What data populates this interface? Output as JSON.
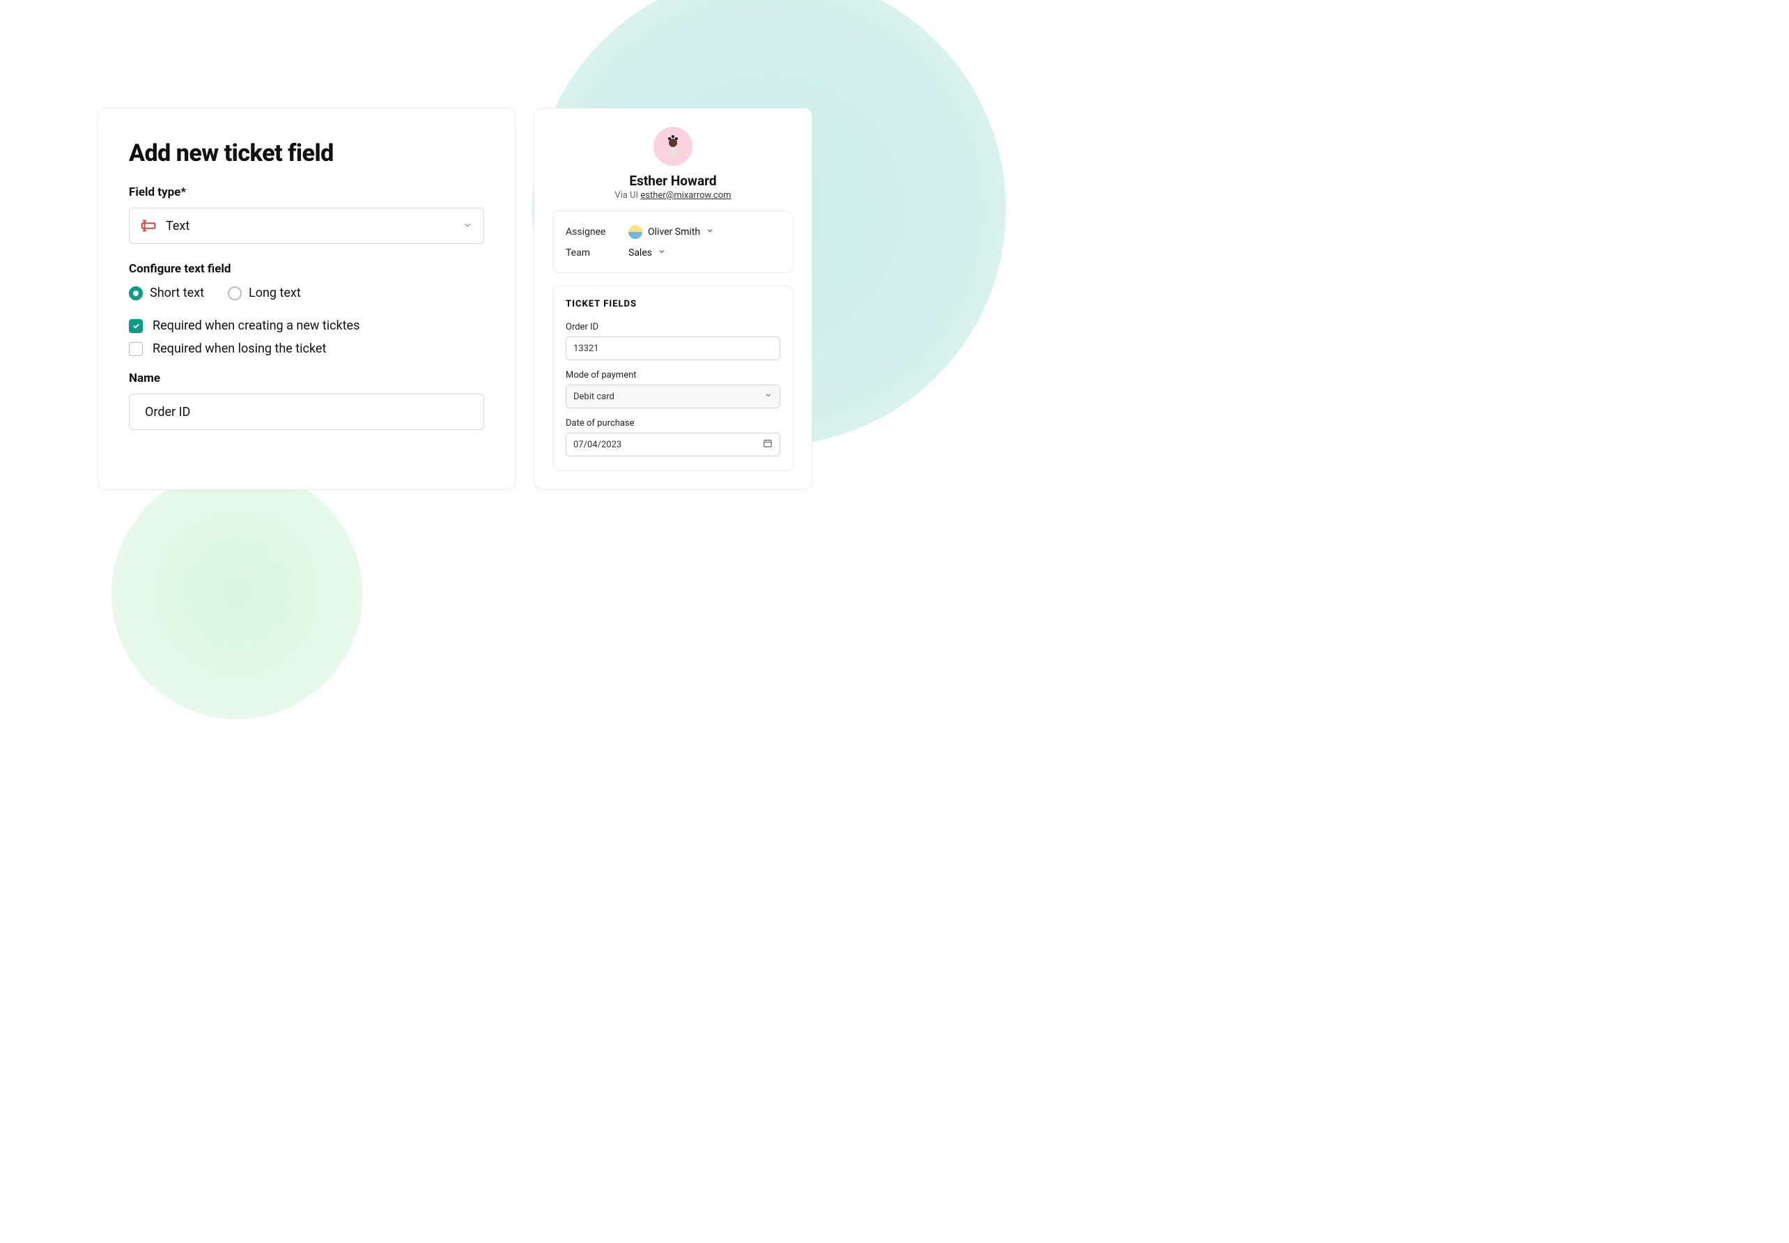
{
  "leftCard": {
    "title": "Add new ticket field",
    "fieldTypeLabel": "Field type*",
    "fieldTypeValue": "Text",
    "configureLabel": "Configure text field",
    "radioShort": "Short text",
    "radioLong": "Long text",
    "checkReqCreate": "Required when creating a new ticktes",
    "checkReqClose": "Required when losing the ticket",
    "nameLabel": "Name",
    "nameValue": "Order ID"
  },
  "rightCard": {
    "profileName": "Esther Howard",
    "viaLabel": "Via UI ",
    "email": "esther@mixarrow.com",
    "assigneeLabel": "Assignee",
    "assigneeValue": "Oliver Smith",
    "teamLabel": "Team",
    "teamValue": "Sales",
    "ticketFieldsHeading": "TICKET FIELDS",
    "orderIdLabel": "Order ID",
    "orderIdValue": "13321",
    "paymentLabel": "Mode of payment",
    "paymentValue": "Debit card",
    "dateLabel": "Date of purchase",
    "dateValue": "07/04/2023"
  }
}
